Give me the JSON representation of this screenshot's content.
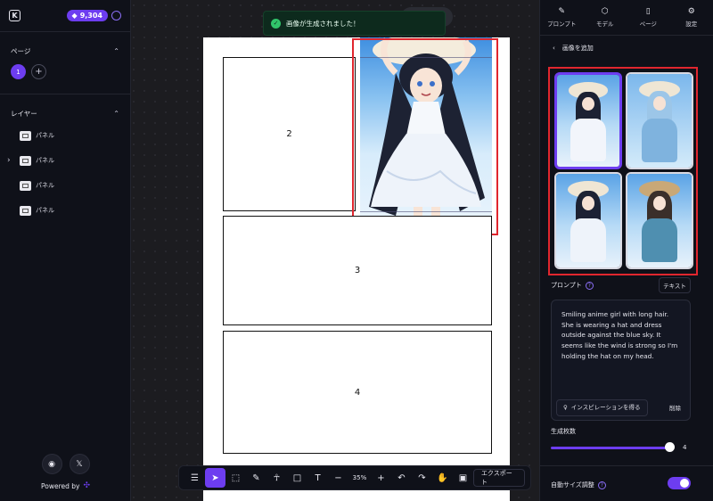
{
  "left": {
    "credits": "9,304",
    "pages_title": "ページ",
    "page_number": "1",
    "add_page": "+",
    "layers_title": "レイヤー",
    "layers": [
      {
        "label": "パネル",
        "caret": ""
      },
      {
        "label": "パネル",
        "caret": "›"
      },
      {
        "label": "パネル",
        "caret": ""
      },
      {
        "label": "パネル",
        "caret": ""
      }
    ],
    "powered_by": "Powered by"
  },
  "toast": {
    "message": "画像が生成されました！"
  },
  "canvas": {
    "panels": [
      "2",
      "3",
      "4"
    ]
  },
  "toolbar": {
    "zoom": "35%",
    "export_label": "エクスポート"
  },
  "right": {
    "tabs": [
      {
        "label": "プロンプト",
        "icon": "pen-icon"
      },
      {
        "label": "モデル",
        "icon": "cube-icon"
      },
      {
        "label": "ページ",
        "icon": "page-icon"
      },
      {
        "label": "設定",
        "icon": "gear-icon"
      }
    ],
    "back_label": "画像を追加",
    "prompt_label": "プロンプト",
    "text_button": "テキスト",
    "prompt_text": "Smiling anime girl with long hair. She is wearing a hat and dress outside against the blue sky. It seems like the wind is strong so I'm holding the hat on my head.",
    "inspiration_button": "インスピレーションを得る",
    "delete_button": "削除",
    "count_label": "生成枚数",
    "count_value": "4",
    "auto_size_label": "自動サイズ調整"
  },
  "colors": {
    "accent": "#6d3df0",
    "highlight": "#e0262e",
    "success": "#31c46a"
  }
}
